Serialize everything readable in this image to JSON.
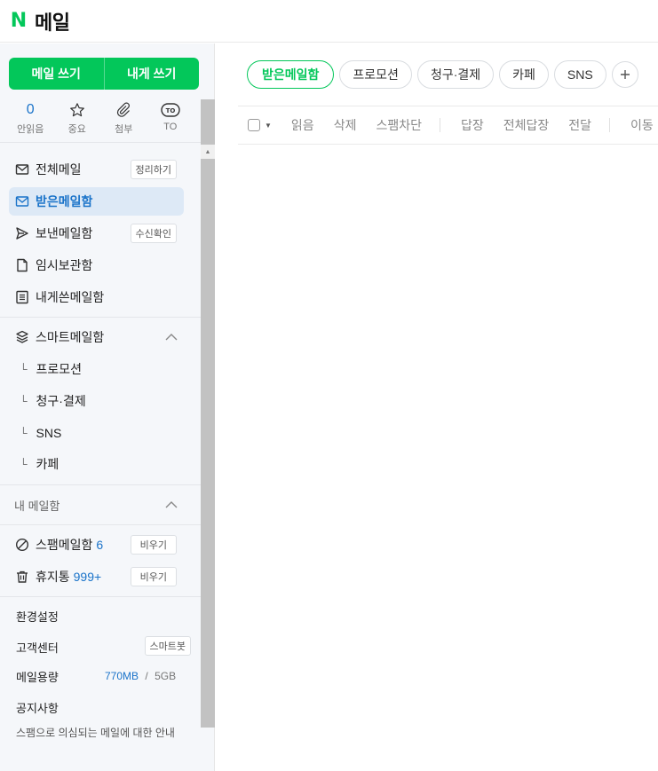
{
  "app": {
    "logo": "N",
    "title": "메일"
  },
  "compose": {
    "write_label": "메일 쓰기",
    "self_label": "내게 쓰기"
  },
  "quick": [
    {
      "value": "0",
      "label": "안읽음",
      "icon": "unread-count"
    },
    {
      "label": "중요",
      "icon": "star-icon"
    },
    {
      "label": "첨부",
      "icon": "paperclip-icon"
    },
    {
      "label": "TO",
      "icon": "to-badge-icon",
      "badge": "TO"
    }
  ],
  "nav": {
    "all": {
      "label": "전체메일",
      "action": "정리하기"
    },
    "inbox": {
      "label": "받은메일함"
    },
    "sent": {
      "label": "보낸메일함",
      "action": "수신확인"
    },
    "drafts": {
      "label": "임시보관함"
    },
    "self": {
      "label": "내게쓴메일함"
    },
    "smart": {
      "label": "스마트메일함",
      "children": [
        "프로모션",
        "청구·결제",
        "SNS",
        "카페"
      ]
    },
    "mine_title": "내 메일함",
    "spam": {
      "label": "스팸메일함",
      "count": "6",
      "action": "비우기"
    },
    "trash": {
      "label": "휴지통",
      "count": "999+",
      "action": "비우기"
    }
  },
  "footer": {
    "settings": "환경설정",
    "support": "고객센터",
    "support_action": "스마트봇",
    "storage_label": "메일용량",
    "storage_used": "770MB",
    "storage_sep": "/",
    "storage_total": "5GB",
    "notice_title": "공지사항",
    "notice_text": "스팸으로 의심되는 메일에 대한 안내"
  },
  "tabs": [
    "받은메일함",
    "프로모션",
    "청구·결제",
    "카페",
    "SNS"
  ],
  "toolbar": {
    "read": "읽음",
    "delete": "삭제",
    "block": "스팸차단",
    "reply": "답장",
    "reply_all": "전체답장",
    "forward": "전달",
    "more": "이동"
  },
  "colors": {
    "brand": "#03c75a",
    "link": "#1a73c9",
    "active_bg": "#dde9f6"
  }
}
